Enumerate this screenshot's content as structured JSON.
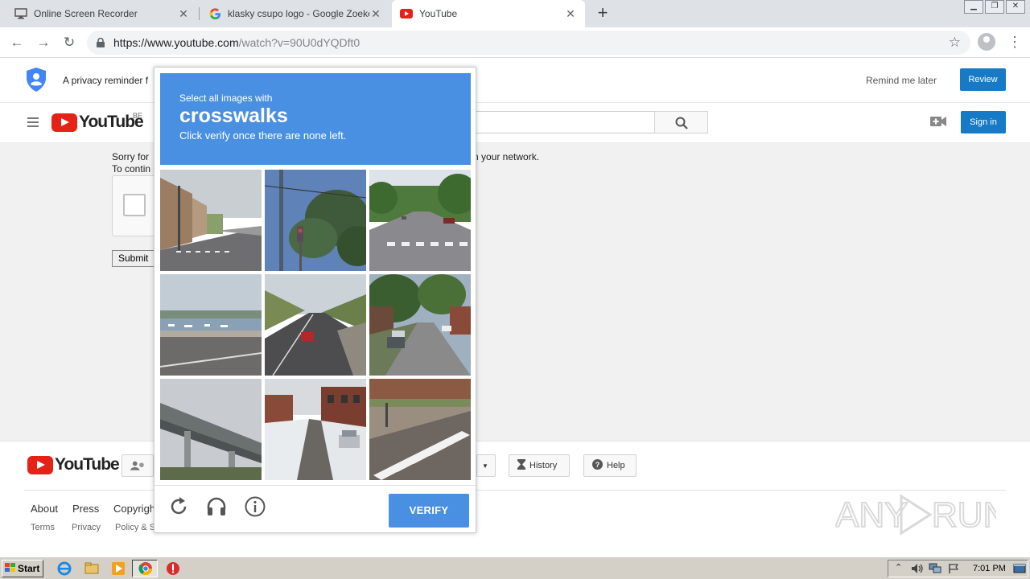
{
  "browser": {
    "tabs": [
      {
        "title": "Online Screen Recorder",
        "icon": "screen-recorder-favicon",
        "active": false
      },
      {
        "title": "klasky csupo logo - Google Zoeken",
        "icon": "google-favicon",
        "active": false
      },
      {
        "title": "YouTube",
        "icon": "youtube-favicon",
        "active": true
      }
    ],
    "url_host": "https://www.youtube.com",
    "url_path": "/watch?v=90U0dYQDft0"
  },
  "privacy_bar": {
    "message": "A privacy reminder f",
    "remind_label": "Remind me later",
    "review_label": "Review"
  },
  "masthead": {
    "logo_text": "YouTube",
    "region": "BE",
    "signin_label": "Sign in"
  },
  "page": {
    "sorry_line1": "Sorry for",
    "sorry_line2": "To contin",
    "sorry_tail": "n your network.",
    "submit_label": "Submit"
  },
  "footer": {
    "logo_text": "YouTube",
    "history_label": "History",
    "help_label": "Help",
    "links_row1": [
      "About",
      "Press",
      "Copyrigh"
    ],
    "links_row2": [
      "Terms",
      "Privacy",
      "Policy & S"
    ],
    "watermark": "ANY RUN"
  },
  "captcha": {
    "line1": "Select all images with",
    "keyword": "crosswalks",
    "line3": "Click verify once there are none left.",
    "verify_label": "VERIFY",
    "accent_color": "#4a90e2",
    "tiles": [
      {
        "scene": "street-buildings-crosswalk"
      },
      {
        "scene": "trees-traffic-light"
      },
      {
        "scene": "road-crosswalk-trees"
      },
      {
        "scene": "harbor-boats-road"
      },
      {
        "scene": "highway-car"
      },
      {
        "scene": "residential-street-cars"
      },
      {
        "scene": "overpass-bridge"
      },
      {
        "scene": "snowy-street-car"
      },
      {
        "scene": "crosswalk-closeup"
      }
    ]
  },
  "taskbar": {
    "start_label": "Start",
    "clock": "7:01 PM"
  }
}
